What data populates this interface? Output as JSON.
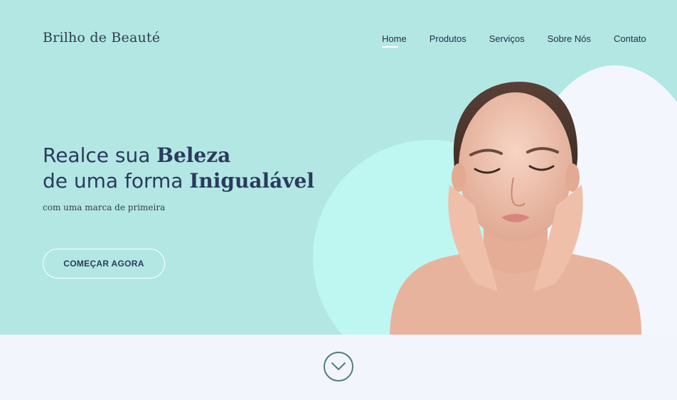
{
  "brand": {
    "name": "Brilho de Beauté"
  },
  "nav": {
    "items": [
      {
        "label": "Home",
        "active": true
      },
      {
        "label": "Produtos",
        "active": false
      },
      {
        "label": "Serviços",
        "active": false
      },
      {
        "label": "Sobre Nós",
        "active": false
      },
      {
        "label": "Contato",
        "active": false
      }
    ]
  },
  "hero": {
    "line1_light": "Realce sua ",
    "line1_strong": "Beleza",
    "line2_light": "de uma forma ",
    "line2_strong": "Inigualável",
    "subtitle": "com uma marca de primeira",
    "cta_label": "COMEÇAR AGORA",
    "image_subject": "woman-portrait"
  },
  "scroll": {
    "icon": "chevron-down-icon"
  },
  "colors": {
    "hero_bg": "#b2e7e4",
    "mint_circle": "#bef7f2",
    "white_circle": "#f3f6fd",
    "text_dark": "#2b3a5c",
    "scroll_ring": "#4f7d80"
  }
}
